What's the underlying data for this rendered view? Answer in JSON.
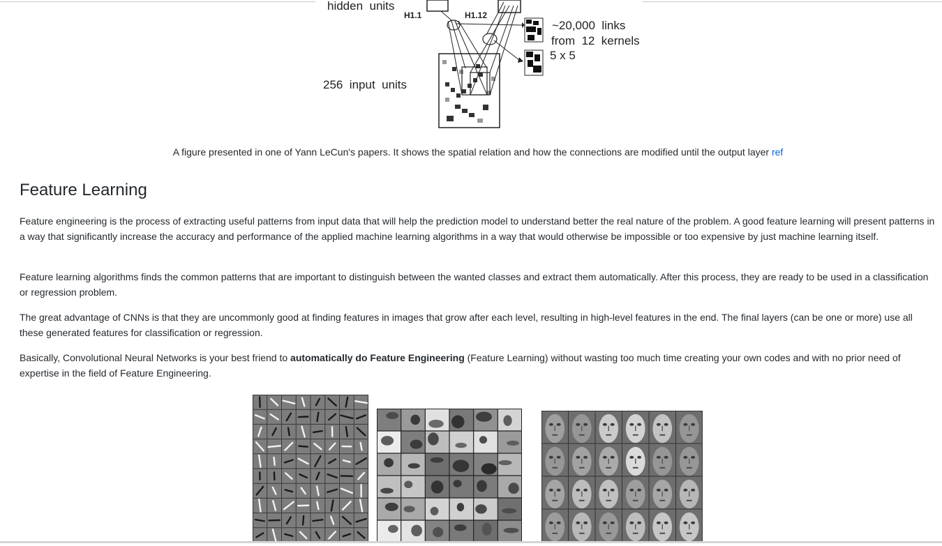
{
  "figure": {
    "labels": {
      "hidden_units": "hidden  units",
      "h1_1": "H1.1",
      "h1_12": "H1.12",
      "links": "~20,000  links",
      "kernels": "from  12  kernels",
      "kernel_size": "5 x 5",
      "input_units": "256  input  units"
    }
  },
  "caption": {
    "text": "A figure presented in one of Yann LeCun's papers. It shows the spatial relation and how the connections are modified until the output layer ",
    "link": "ref"
  },
  "section": {
    "title": "Feature Learning",
    "paragraphs": {
      "p1": "Feature engineering is the process of extracting useful patterns from input data that will help the prediction model to understand better the real nature of the problem. A good feature learning will present patterns in a way that significantly increase the accuracy and performance of the applied machine learning algorithms in a way that would otherwise be impossible or too expensive by just machine learning itself.",
      "p2": "Feature learning algorithms finds the common patterns that are important to distinguish between the wanted classes and extract them automatically. After this process, they are ready to be used in a classification or regression problem.",
      "p3": "The great advantage of CNNs is that they are uncommonly good at finding features in images that grow after each level, resulting in high-level features in the end. The final layers (can be one or more) use all these generated features for classification or regression.",
      "p4_before": "Basically, Convolutional Neural Networks is your best friend to ",
      "p4_bold": "automatically do Feature Engineering",
      "p4_after": " (Feature Learning) without wasting too much time creating your own codes and with no prior need of expertise in the field of Feature Engineering."
    }
  }
}
